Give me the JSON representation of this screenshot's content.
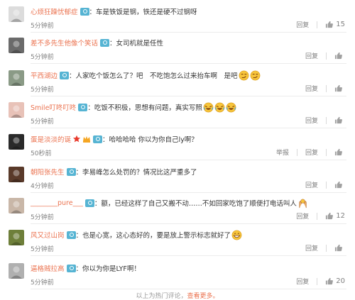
{
  "comments": [
    {
      "user": "心烦狂躁忧郁症",
      "text": "：车是铁饭是钢，铁还是硬不过钢呀",
      "time": "5分钟前",
      "reply": "回复",
      "likes": "15",
      "avatar": "#dcdcdc",
      "emojis": [],
      "extra_icons": []
    },
    {
      "user": "差不多先生他像个笑话",
      "text": "：女司机就是任性",
      "time": "5分钟前",
      "reply": "回复",
      "likes": "",
      "avatar": "#6b6b6b",
      "emojis": [],
      "extra_icons": []
    },
    {
      "user": "平西湖边",
      "text": "：人家吃个饭怎么了？吧　不吃饱怎么过来抬车啊　是吧",
      "time": "5分钟前",
      "reply": "回复",
      "likes": "",
      "avatar": "#8a9a86",
      "emojis": [
        "smirk-emoji",
        "smirk-emoji"
      ],
      "extra_icons": []
    },
    {
      "user": "Smile叮咚叮咚",
      "text": "：吃饭不积极，思想有问题，真实写照",
      "time": "5分钟前",
      "reply": "回复",
      "likes": "",
      "avatar": "#e8c2b8",
      "emojis": [
        "laugh-cry-emoji",
        "laugh-cry-emoji",
        "laugh-cry-emoji"
      ],
      "extra_icons": []
    },
    {
      "user": "蛋是淡淡的诞",
      "text": "：哈哈哈哈 你以为你自己ly啊？",
      "time": "50秒前",
      "reply": "回复",
      "report": "举报",
      "likes": "",
      "avatar": "#2a2a2a",
      "emojis": [],
      "extra_icons": [
        "star-icon",
        "member-crown-icon"
      ]
    },
    {
      "user": "朝阳张先生",
      "text": "：李易峰怎么处罚的？情况比这严重多了",
      "time": "4分钟前",
      "reply": "回复",
      "likes": "",
      "avatar": "#5a3a2a",
      "emojis": [],
      "extra_icons": []
    },
    {
      "user": "________pure___",
      "text": "：额，已经这样了自己又搬不动……不如回家吃饱了顺便打电话叫人",
      "time": "5分钟前",
      "reply": "回复",
      "likes": "12",
      "avatar": "#c9b7a8",
      "emojis": [
        "hands-emoji"
      ],
      "extra_icons": []
    },
    {
      "user": "风又过山岗",
      "text": "：也是心宽，这心态好的，要是放上警示标志就好了",
      "time": "5分钟前",
      "reply": "回复",
      "likes": "",
      "avatar": "#6e7f3a",
      "emojis": [
        "grin-emoji"
      ],
      "extra_icons": []
    },
    {
      "user": "逼格贼拉高",
      "text": "：你以为你是LYF啊！",
      "time": "5分钟前",
      "reply": "回复",
      "likes": "20",
      "avatar": "#b0b0b0",
      "emojis": [],
      "extra_icons": []
    }
  ],
  "footer": {
    "text": "以上为热门评论，",
    "more": "查看更多。"
  },
  "colors": {
    "username": "#eb7350",
    "badge": "#56b4d3",
    "meta": "#808080"
  }
}
